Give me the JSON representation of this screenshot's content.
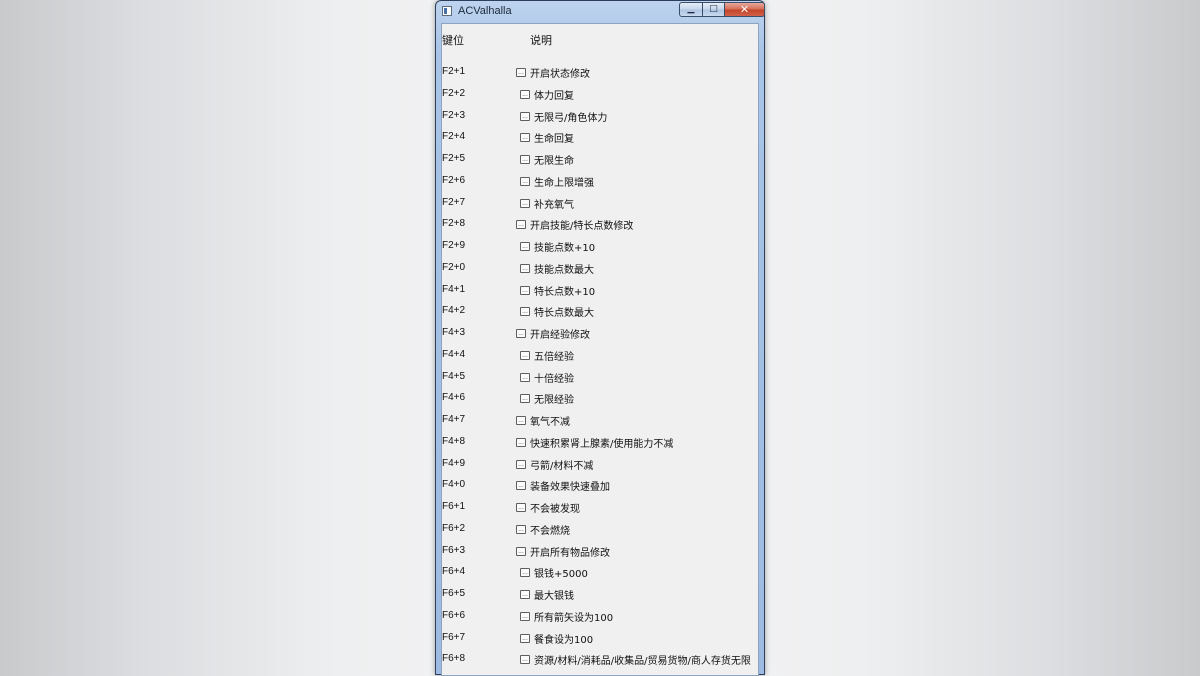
{
  "window": {
    "title": "ACValhalla"
  },
  "header": {
    "key_label": "键位",
    "desc_label": "说明"
  },
  "rows": [
    {
      "key": "F2+1",
      "desc": "开启状态修改",
      "level": 0
    },
    {
      "key": "F2+2",
      "desc": "体力回复",
      "level": 1
    },
    {
      "key": "F2+3",
      "desc": "无限弓/角色体力",
      "level": 1
    },
    {
      "key": "F2+4",
      "desc": "生命回复",
      "level": 1
    },
    {
      "key": "F2+5",
      "desc": "无限生命",
      "level": 1
    },
    {
      "key": "F2+6",
      "desc": "生命上限增强",
      "level": 1
    },
    {
      "key": "F2+7",
      "desc": "补充氧气",
      "level": 1
    },
    {
      "key": "F2+8",
      "desc": "开启技能/特长点数修改",
      "level": 0
    },
    {
      "key": "F2+9",
      "desc": "技能点数+10",
      "level": 1
    },
    {
      "key": "F2+0",
      "desc": "技能点数最大",
      "level": 1
    },
    {
      "key": "F4+1",
      "desc": "特长点数+10",
      "level": 1
    },
    {
      "key": "F4+2",
      "desc": "特长点数最大",
      "level": 1
    },
    {
      "key": "F4+3",
      "desc": "开启经验修改",
      "level": 0
    },
    {
      "key": "F4+4",
      "desc": "五倍经验",
      "level": 1
    },
    {
      "key": "F4+5",
      "desc": "十倍经验",
      "level": 1
    },
    {
      "key": "F4+6",
      "desc": "无限经验",
      "level": 1
    },
    {
      "key": "F4+7",
      "desc": "氧气不减",
      "level": 0
    },
    {
      "key": "F4+8",
      "desc": "快速积累肾上腺素/使用能力不减",
      "level": 0
    },
    {
      "key": "F4+9",
      "desc": "弓箭/材料不减",
      "level": 0
    },
    {
      "key": "F4+0",
      "desc": "装备效果快速叠加",
      "level": 0
    },
    {
      "key": "F6+1",
      "desc": "不会被发现",
      "level": 0
    },
    {
      "key": "F6+2",
      "desc": "不会燃烧",
      "level": 0
    },
    {
      "key": "F6+3",
      "desc": "开启所有物品修改",
      "level": 0
    },
    {
      "key": "F6+4",
      "desc": "银钱+5000",
      "level": 1
    },
    {
      "key": "F6+5",
      "desc": "最大银钱",
      "level": 1
    },
    {
      "key": "F6+6",
      "desc": "所有箭矢设为100",
      "level": 1
    },
    {
      "key": "F6+7",
      "desc": "餐食设为100",
      "level": 1
    },
    {
      "key": "F6+8",
      "desc": "资源/材料/消耗品/收集品/贸易货物/商人存货无限",
      "level": 1
    }
  ],
  "colors": {
    "title_bar": "#a9c4e6",
    "close_button": "#c4452b",
    "client_bg": "#f0f0f0"
  }
}
